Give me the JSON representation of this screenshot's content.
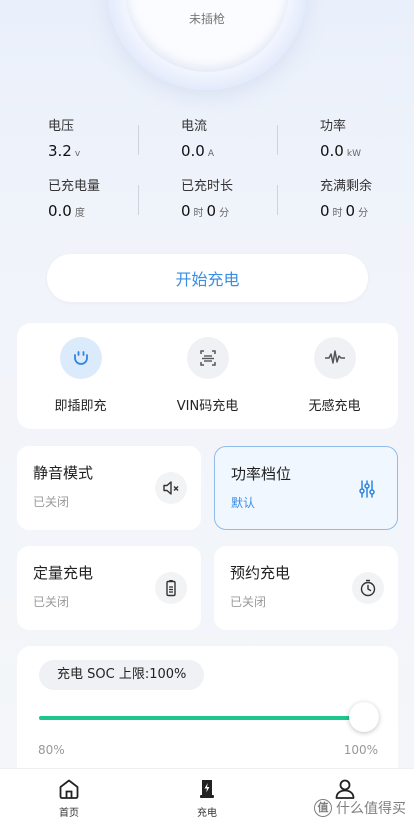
{
  "status": {
    "label": "未插枪"
  },
  "stats": {
    "voltage": {
      "label": "电压",
      "value": "3.2",
      "unit": "v"
    },
    "current": {
      "label": "电流",
      "value": "0.0",
      "unit": "A"
    },
    "power": {
      "label": "功率",
      "value": "0.0",
      "unit": "kW"
    },
    "charged_energy": {
      "label": "已充电量",
      "value": "0.0",
      "unit": "度"
    },
    "charged_time": {
      "label": "已充时长",
      "hours": "0",
      "hours_unit": "时",
      "minutes": "0",
      "minutes_unit": "分"
    },
    "time_to_full": {
      "label": "充满剩余",
      "hours": "0",
      "hours_unit": "时",
      "minutes": "0",
      "minutes_unit": "分"
    }
  },
  "start_button": {
    "label": "开始充电"
  },
  "modes": [
    {
      "label": "即插即充",
      "icon": "plug-icon",
      "active": true
    },
    {
      "label": "VIN码充电",
      "icon": "vin-scan-icon",
      "active": false
    },
    {
      "label": "无感充电",
      "icon": "waveform-icon",
      "active": false
    }
  ],
  "tiles": {
    "silent": {
      "title": "静音模式",
      "status": "已关闭",
      "icon": "mute-icon"
    },
    "power_level": {
      "title": "功率档位",
      "status": "默认",
      "icon": "sliders-icon"
    },
    "quota": {
      "title": "定量充电",
      "status": "已关闭",
      "icon": "battery-icon"
    },
    "schedule": {
      "title": "预约充电",
      "status": "已关闭",
      "icon": "timer-icon"
    }
  },
  "soc": {
    "label": "充电 SOC 上限:100%",
    "min_label": "80%",
    "max_label": "100%",
    "fill_fraction": 1.0,
    "accent": "#1fc58e"
  },
  "tabs": [
    {
      "label": "首页",
      "icon": "home-icon"
    },
    {
      "label": "充电",
      "icon": "charging-icon"
    },
    {
      "label": "",
      "icon": "profile-icon"
    }
  ],
  "watermark": {
    "logo": "值",
    "text": "什么值得买"
  }
}
